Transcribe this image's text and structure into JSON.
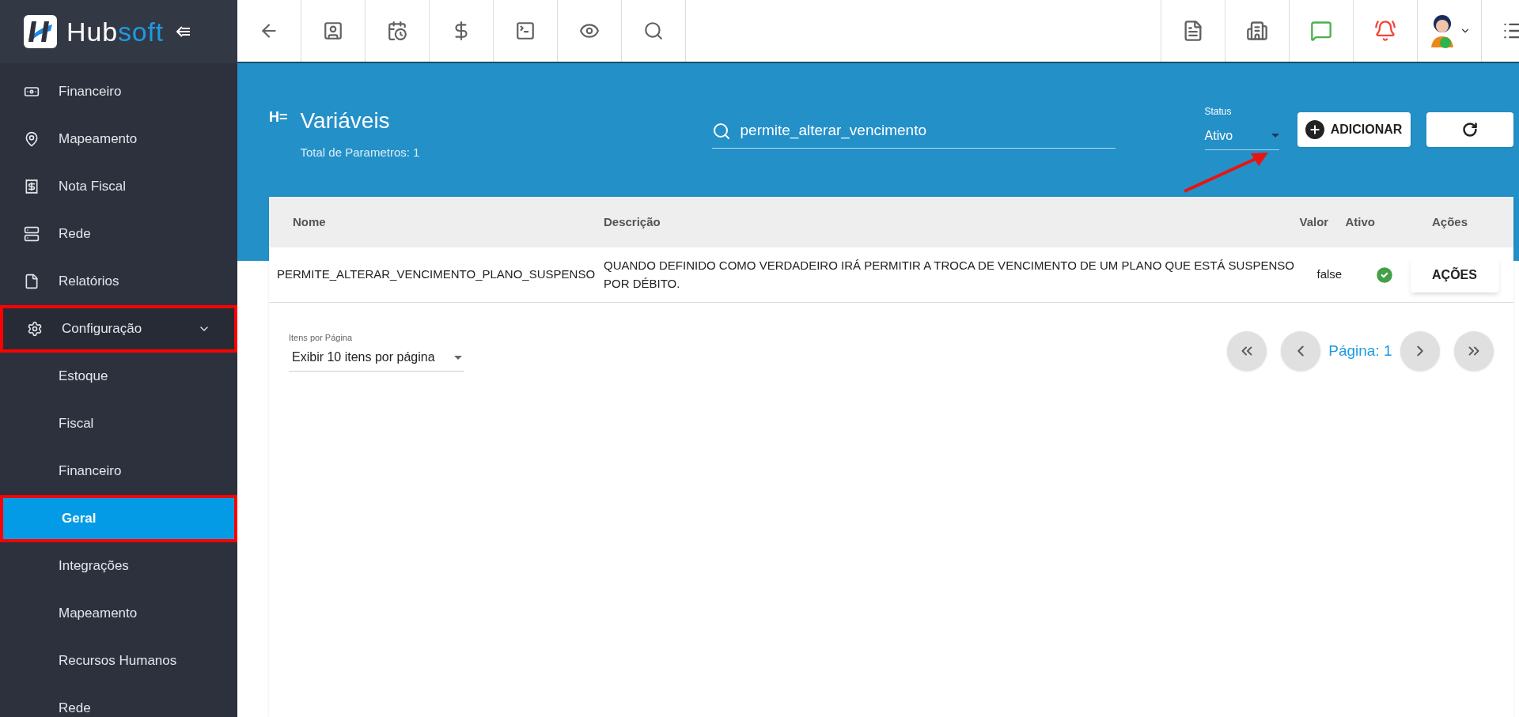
{
  "logo": {
    "text_1": "Hub",
    "text_2": "soft"
  },
  "sidebar": {
    "items": [
      {
        "label": "Financeiro",
        "selected": false,
        "annotated": false
      },
      {
        "label": "Mapeamento",
        "selected": false,
        "annotated": false
      },
      {
        "label": "Nota Fiscal",
        "selected": false,
        "annotated": false
      },
      {
        "label": "Rede",
        "selected": false,
        "annotated": false
      },
      {
        "label": "Relatórios",
        "selected": false,
        "annotated": false
      },
      {
        "label": "Configuração",
        "selected": false,
        "annotated": true,
        "expanded": true,
        "children": [
          {
            "label": "Estoque",
            "selected": false,
            "annotated": false
          },
          {
            "label": "Fiscal",
            "selected": false,
            "annotated": false
          },
          {
            "label": "Financeiro",
            "selected": false,
            "annotated": false
          },
          {
            "label": "Geral",
            "selected": true,
            "annotated": true
          },
          {
            "label": "Integrações",
            "selected": false,
            "annotated": false
          },
          {
            "label": "Mapeamento",
            "selected": false,
            "annotated": false
          },
          {
            "label": "Recursos Humanos",
            "selected": false,
            "annotated": false
          },
          {
            "label": "Rede",
            "selected": false,
            "annotated": false
          }
        ]
      }
    ]
  },
  "header": {
    "icon_text": "H=",
    "title": "Variáveis",
    "subtitle": "Total de Parametros: 1",
    "search": {
      "value": "permite_alterar_vencimento"
    },
    "status": {
      "label": "Status",
      "value": "Ativo"
    },
    "add_button": "ADICIONAR"
  },
  "table": {
    "columns": [
      "Nome",
      "Descrição",
      "Valor",
      "Ativo",
      "Ações"
    ],
    "rows": [
      {
        "nome": "PERMITE_ALTERAR_VENCIMENTO_PLANO_SUSPENSO",
        "descricao": "QUANDO DEFINIDO COMO VERDADEIRO IRÁ PERMITIR A TROCA DE VENCIMENTO DE UM PLANO QUE ESTÁ SUSPENSO POR DÉBITO.",
        "valor": "false",
        "ativo": true,
        "acoes": "AÇÕES"
      }
    ]
  },
  "pagination": {
    "per_page_label": "Itens por Página",
    "per_page_value": "Exibir 10 itens por página",
    "page": "Página: 1"
  }
}
